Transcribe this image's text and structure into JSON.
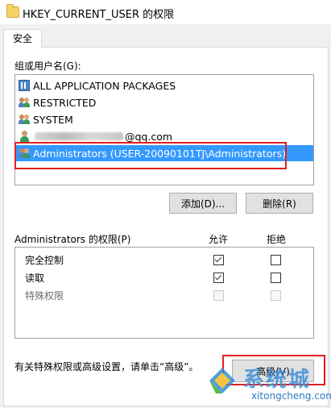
{
  "window": {
    "title": "HKEY_CURRENT_USER 的权限"
  },
  "tabs": [
    {
      "label": "安全"
    }
  ],
  "groups": {
    "label": "组或用户名(G):",
    "items": [
      {
        "label": "ALL APPLICATION PACKAGES",
        "icon": "app-packages-icon"
      },
      {
        "label": "RESTRICTED",
        "icon": "users-group-icon"
      },
      {
        "label": "SYSTEM",
        "icon": "users-group-icon"
      },
      {
        "label": "@qq.com",
        "icon": "user-icon"
      },
      {
        "label": "Administrators (USER-20090101TJ\\Administrators)",
        "icon": "users-group-icon",
        "selected": true
      }
    ]
  },
  "buttons": {
    "add": "添加(D)...",
    "remove": "删除(R)",
    "advanced": "高级(V)"
  },
  "permissions": {
    "label": "Administrators 的权限(P)",
    "allow_header": "允许",
    "deny_header": "拒绝",
    "rows": [
      {
        "label": "完全控制",
        "allow": true,
        "deny": false,
        "disabled": false
      },
      {
        "label": "读取",
        "allow": true,
        "deny": false,
        "disabled": false
      },
      {
        "label": "特殊权限",
        "allow": false,
        "deny": false,
        "disabled": true
      }
    ]
  },
  "footer": {
    "text": "有关特殊权限或高级设置，请单击“高级”。"
  },
  "watermark": {
    "brand": "系统城",
    "url": "xitongcheng.com"
  },
  "colors": {
    "selection": "#3399ff",
    "highlight": "#e02020",
    "watermark": "#3d8fd6"
  }
}
